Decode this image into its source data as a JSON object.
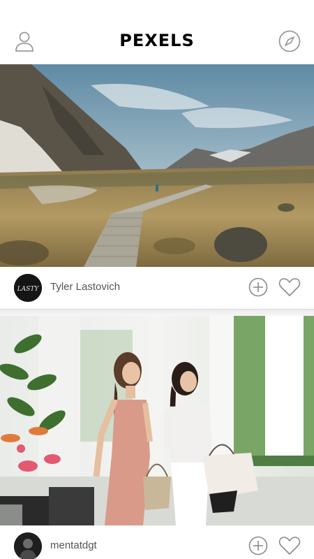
{
  "header": {
    "title": "PEXELS",
    "left_icon": "user-icon",
    "right_icon": "compass-icon"
  },
  "feed": [
    {
      "author": "Tyler Lastovich",
      "avatar_text": "LASTY",
      "photo_subject": "mountain-boardwalk",
      "actions": {
        "add_icon": "plus-circle-icon",
        "like_icon": "heart-icon"
      }
    },
    {
      "author": "mentatdgt",
      "photo_subject": "two-women-shopping",
      "actions": {
        "add_icon": "plus-circle-icon",
        "like_icon": "heart-icon"
      }
    }
  ]
}
